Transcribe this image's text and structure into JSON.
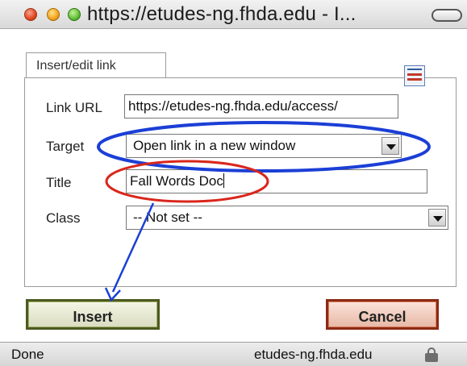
{
  "window": {
    "title": "https://etudes-ng.fhda.edu - I..."
  },
  "dialog": {
    "tab_label": "Insert/edit link",
    "fields": {
      "link_url": {
        "label": "Link URL",
        "value": "https://etudes-ng.fhda.edu/access/"
      },
      "target": {
        "label": "Target",
        "selected": "Open link in a new window"
      },
      "title": {
        "label": "Title",
        "value": "Fall Words Doc"
      },
      "class": {
        "label": "Class",
        "selected": "-- Not set --"
      }
    },
    "buttons": {
      "insert": "Insert",
      "cancel": "Cancel"
    }
  },
  "statusbar": {
    "status": "Done",
    "host": "etudes-ng.fhda.edu"
  },
  "icons": {
    "browse": "file-browser-icon",
    "lock": "lock-icon"
  },
  "annotations": {
    "blue": "#1b3fd6",
    "red": "#d9261c"
  }
}
